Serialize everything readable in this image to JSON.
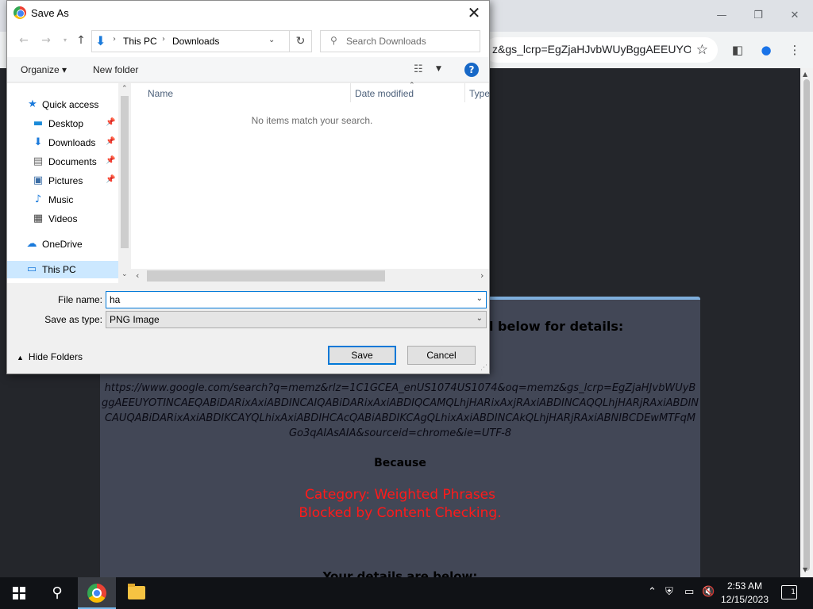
{
  "browser": {
    "url": "z&gs_lcrp=EgZjaHJvbWUyBggAEEUYO...",
    "window_controls": {
      "minimize": "—",
      "restore": "❐",
      "close": "✕"
    }
  },
  "page": {
    "details_heading": "l below for details:",
    "blocked_url": "https://www.google.com/search?q=memz&rlz=1C1GCEA_enUS1074US1074&oq=memz&gs_lcrp=EgZjaHJvbWUyBggAEEUYOTINCAEQABiDARixAxiABDINCAIQABiDARixAxiABDIQCAMQLhjHARixAxjRAxiABDINCAQQLhjHARjRAxiABDINCAUQABiDARixAxiABDIKCAYQLhixAxiABDIHCAcQABiABDIKCAgQLhixAxiABDINCAkQLhjHARjRAxiABNIBCDEwMTFqMGo3qAIAsAIA&sourceid=chrome&ie=UTF-8",
    "because": "Because",
    "reason_line1": "Category: Weighted Phrases",
    "reason_line2": "Blocked by Content Checking.",
    "details_below": "Your details are below:"
  },
  "dialog": {
    "title": "Save As",
    "close": "✕",
    "breadcrumbs": [
      "This PC",
      "Downloads"
    ],
    "search_placeholder": "Search Downloads",
    "commands": {
      "organize": "Organize",
      "new_folder": "New folder"
    },
    "help": "?",
    "nav_items": [
      {
        "label": "Quick access",
        "icon": "star-icon"
      },
      {
        "label": "Desktop",
        "icon": "desktop-icon",
        "pinned": true
      },
      {
        "label": "Downloads",
        "icon": "download-icon",
        "pinned": true
      },
      {
        "label": "Documents",
        "icon": "document-icon",
        "pinned": true
      },
      {
        "label": "Pictures",
        "icon": "pictures-icon",
        "pinned": true
      },
      {
        "label": "Music",
        "icon": "music-icon"
      },
      {
        "label": "Videos",
        "icon": "videos-icon"
      },
      {
        "label": "OneDrive",
        "icon": "cloud-icon"
      },
      {
        "label": "This PC",
        "icon": "computer-icon",
        "selected": true
      }
    ],
    "columns": [
      "Name",
      "Date modified",
      "Type"
    ],
    "empty_message": "No items match your search.",
    "filename_label": "File name:",
    "filename_value": "ha",
    "savetype_label": "Save as type:",
    "savetype_value": "PNG Image",
    "hide_folders": "Hide Folders",
    "save_label": "Save",
    "cancel_label": "Cancel"
  },
  "taskbar": {
    "time": "2:53 AM",
    "date": "12/15/2023",
    "notification_count": "1"
  },
  "colors": {
    "accent": "#0078d7",
    "blocked_reason": "#ff1a1a",
    "panel_bg": "#424756"
  }
}
